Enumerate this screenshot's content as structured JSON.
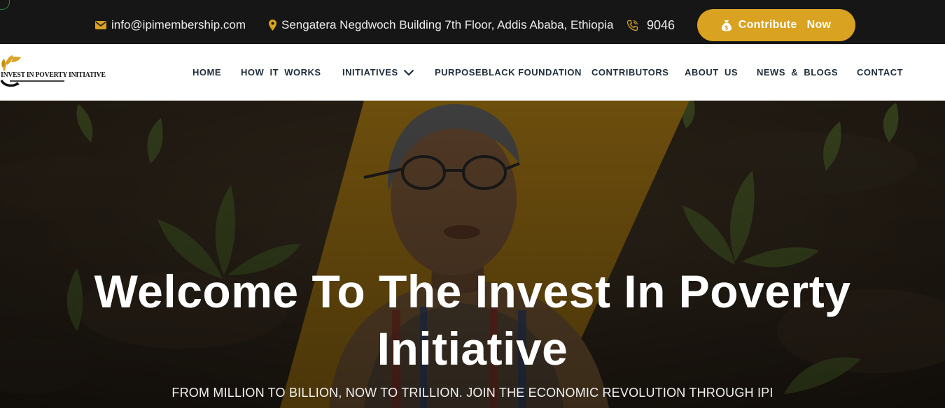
{
  "topbar": {
    "email": "info@ipimembership.com",
    "address": "Sengatera Negdwoch Building 7th Floor, Addis Ababa, Ethiopia",
    "phone": "9046",
    "contribute_label": "Contribute",
    "contribute_label_2": "Now",
    "icons": {
      "email": "envelope-icon",
      "address": "map-pin-icon",
      "phone": "phone-icon",
      "contribute": "money-bag-icon"
    }
  },
  "logo": {
    "name": "INVEST IN POVERTY INITIATIVE"
  },
  "nav": {
    "items": [
      {
        "label": "HOME"
      },
      {
        "label": "HOW  IT  WORKS"
      },
      {
        "label": "INITIATIVES"
      },
      {
        "label": "PURPOSEBLACK FOUNDATION"
      },
      {
        "label": "CONTRIBUTORS"
      },
      {
        "label": "ABOUT  US"
      },
      {
        "label": "NEWS  &  BLOGS"
      },
      {
        "label": "CONTACT"
      }
    ],
    "dropdown_icon": "chevron-down-icon"
  },
  "hero": {
    "title_line1": "Welcome To The Invest In Poverty",
    "title_line2": "Initiative",
    "subtitle": "FROM MILLION TO BILLION, NOW TO TRILLION. JOIN THE ECONOMIC REVOLUTION THROUGH IPI"
  },
  "colors": {
    "accent": "#d9a221",
    "topbar_bg": "#161616",
    "nav_text": "#1f2d3a",
    "hero_text": "#ffffff"
  }
}
